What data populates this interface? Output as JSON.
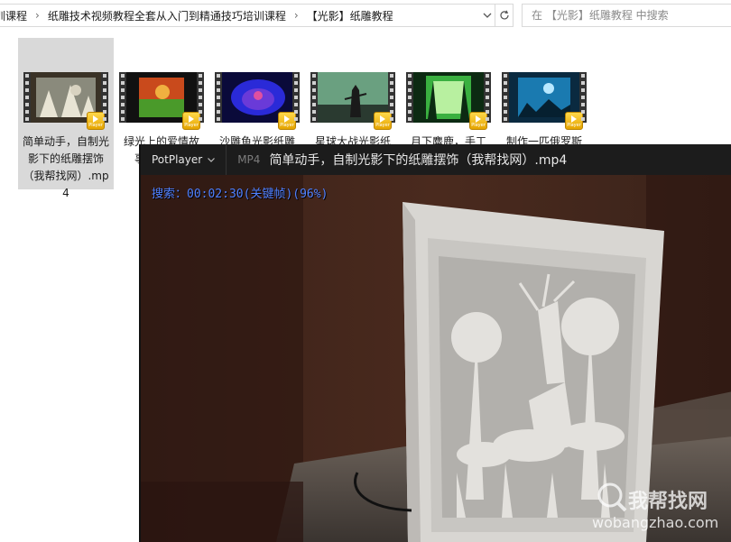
{
  "explorer": {
    "breadcrumb": [
      "训课程",
      "纸雕技术视频教程全套从入门到精通技巧培训课程",
      "【光影】纸雕教程"
    ],
    "search_placeholder": "在 【光影】纸雕教程 中搜索"
  },
  "files": [
    {
      "name": "简单动手，自制光影下的纸雕摆饰（我帮找网）.mp4",
      "selected": true,
      "badge_text": "Player"
    },
    {
      "name": "绿光上的爱情故事，……雕",
      "selected": false,
      "badge_text": "Player"
    },
    {
      "name": "沙雕鱼光影纸雕",
      "selected": false,
      "badge_text": "Player"
    },
    {
      "name": "星球大战光影纸",
      "selected": false,
      "badge_text": "Player"
    },
    {
      "name": "月下麋鹿，手工",
      "selected": false,
      "badge_text": "Player"
    },
    {
      "name": "制作一匹俄罗斯",
      "selected": false,
      "badge_text": "Player"
    }
  ],
  "player": {
    "brand": "PotPlayer",
    "format": "MP4",
    "title": "简单动手，自制光影下的纸雕摆饰（我帮找网）.mp4",
    "osd": "搜索：00:02:30(关键帧)(96%)"
  },
  "watermark": {
    "name": "我帮找网",
    "url": "wobangzhao.com"
  },
  "colors": {
    "osd_text": "#4f80ff",
    "selected_item": "#d9d9d9",
    "player_titlebar": "#1c1c1c"
  }
}
